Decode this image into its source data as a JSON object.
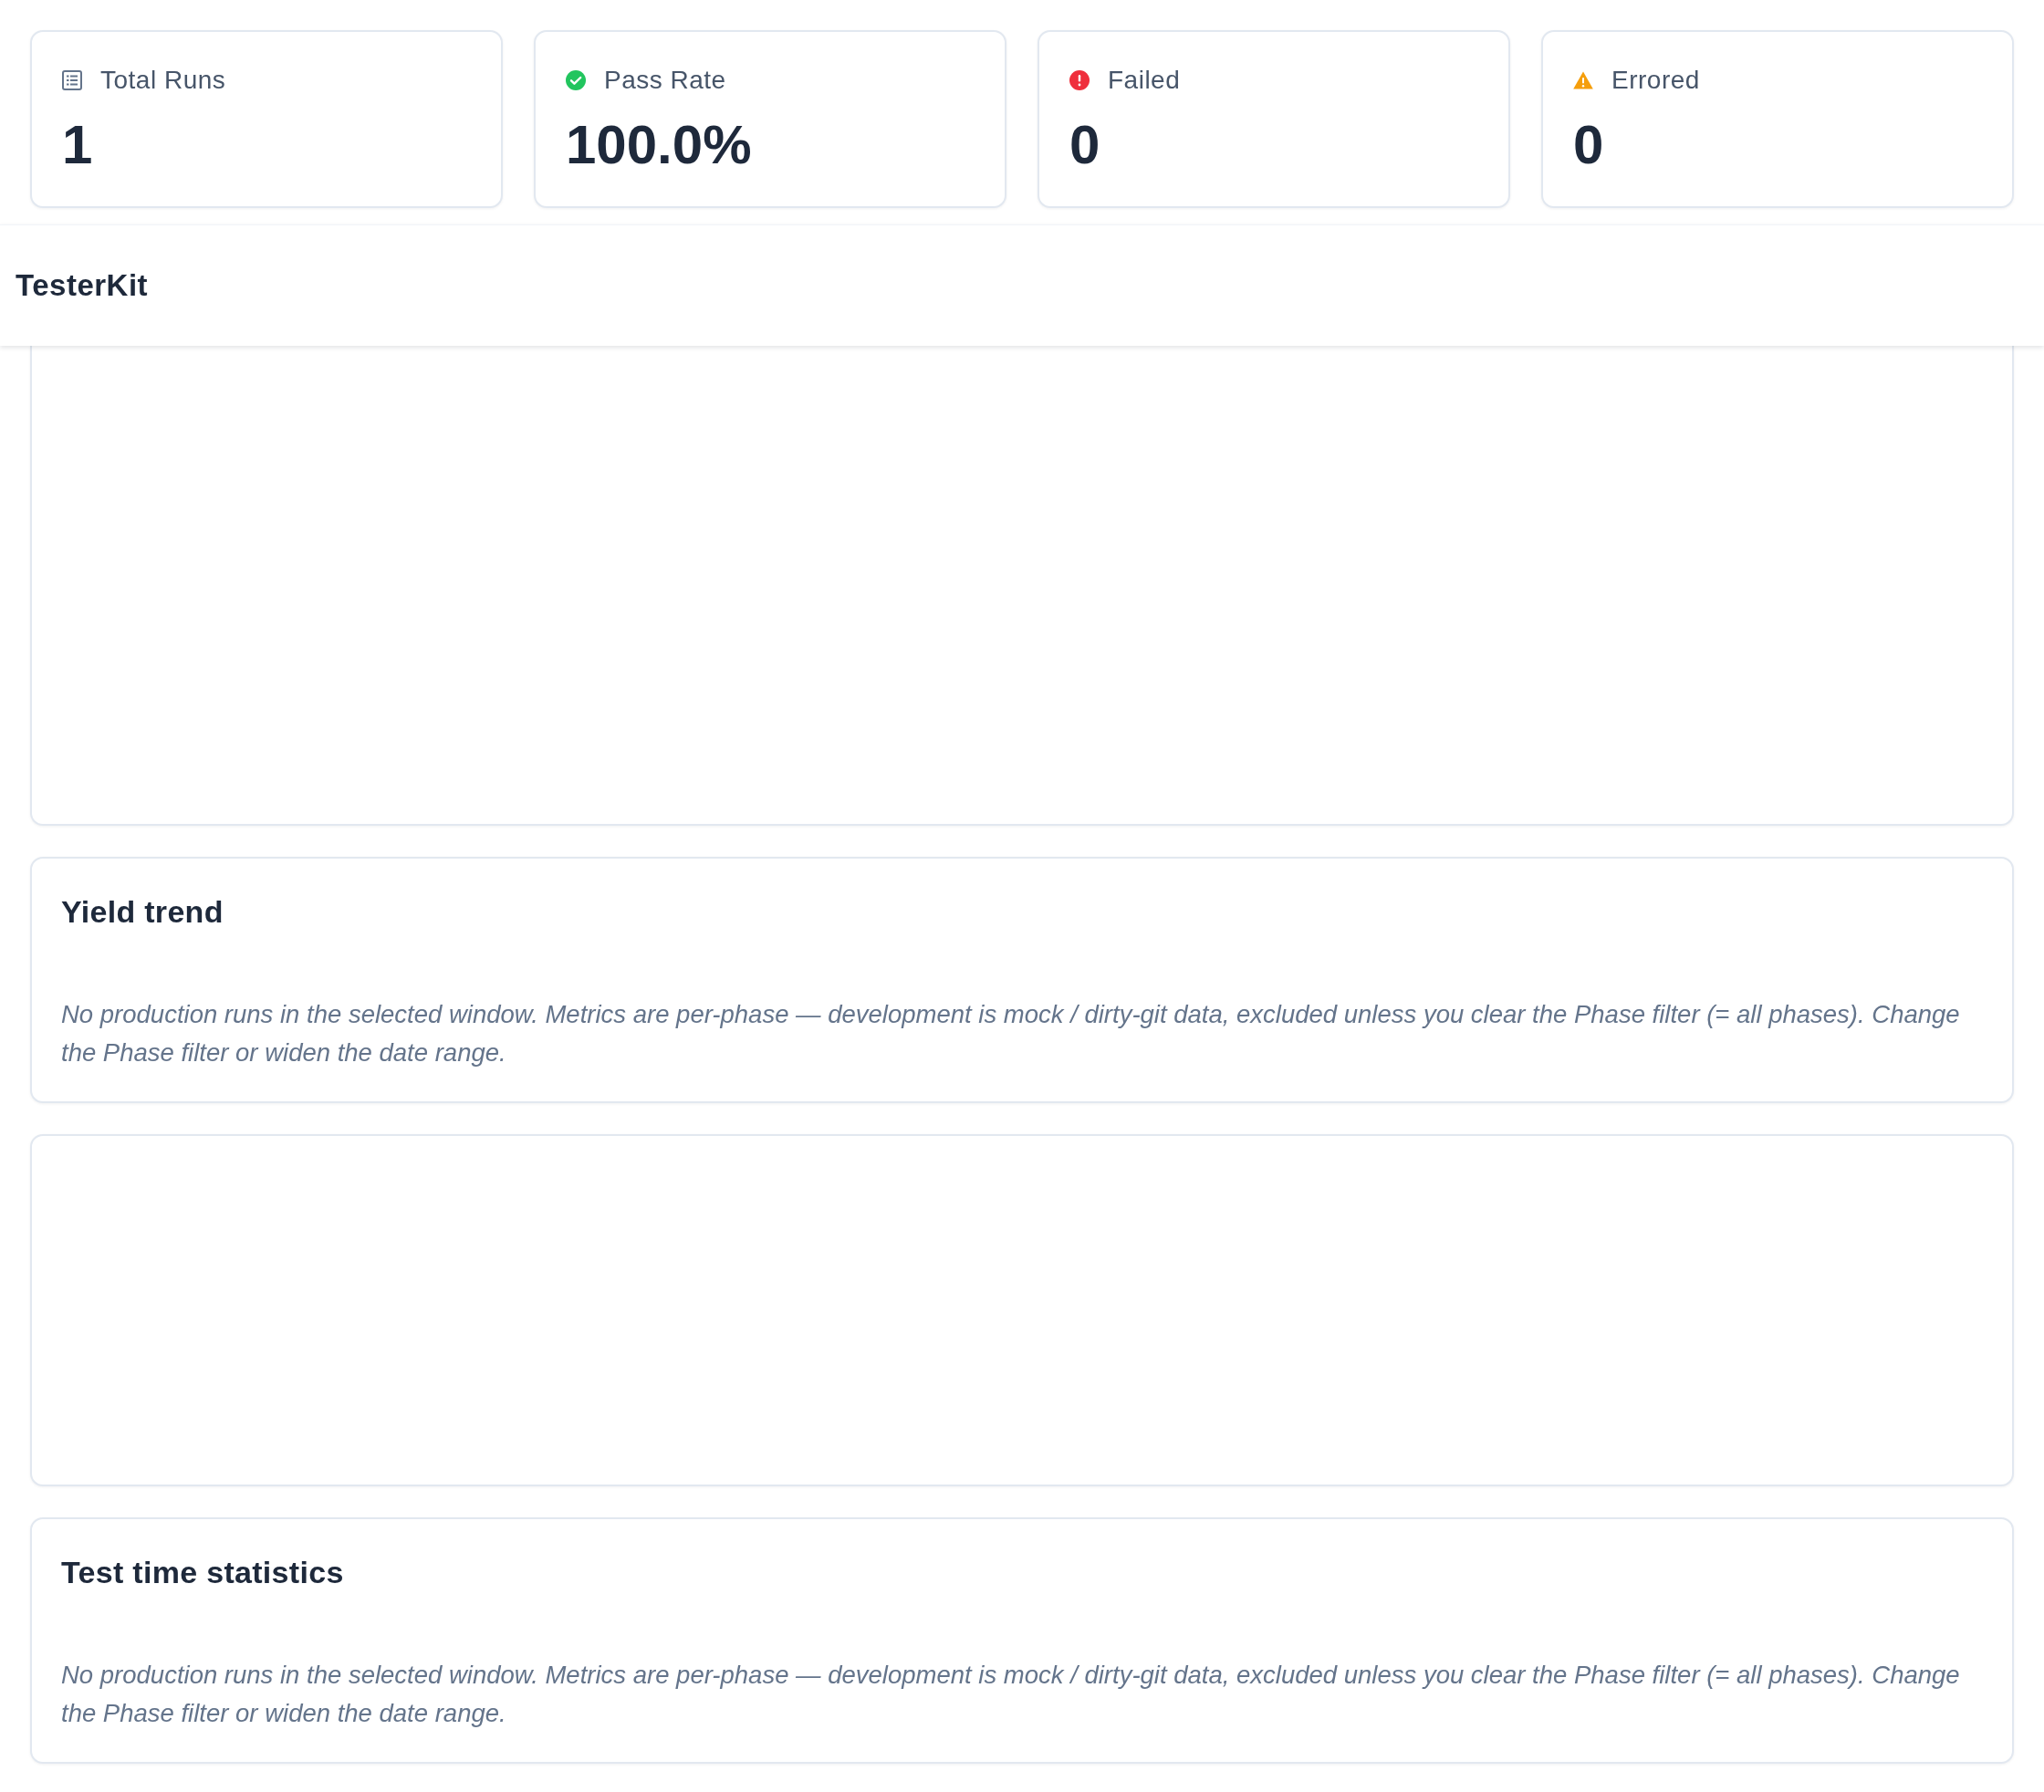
{
  "stats": [
    {
      "kind": "total",
      "color": "#64748b",
      "label": "Total Runs",
      "value": "1"
    },
    {
      "kind": "passed",
      "color": "#22c55e",
      "label": "Pass Rate",
      "value": "100.0%"
    },
    {
      "kind": "failed",
      "color": "#ef2f3c",
      "label": "Failed",
      "value": "0"
    },
    {
      "kind": "errored",
      "color": "#f59e0b",
      "label": "Errored",
      "value": "0"
    }
  ],
  "header": {
    "title": "TesterKit"
  },
  "panels": [
    {
      "kind": "blank"
    },
    {
      "kind": "notice",
      "title": "Yield trend",
      "message": "No production runs in the selected window. Metrics are per-phase — development is mock / dirty-git data, excluded unless you clear the Phase filter (= all phases). Change the Phase filter or widen the date range."
    },
    {
      "kind": "blank"
    },
    {
      "kind": "notice",
      "title": "Test time statistics",
      "message": "No production runs in the selected window. Metrics are per-phase — development is mock / dirty-git data, excluded unless you clear the Phase filter (= all phases). Change the Phase filter or widen the date range."
    }
  ]
}
